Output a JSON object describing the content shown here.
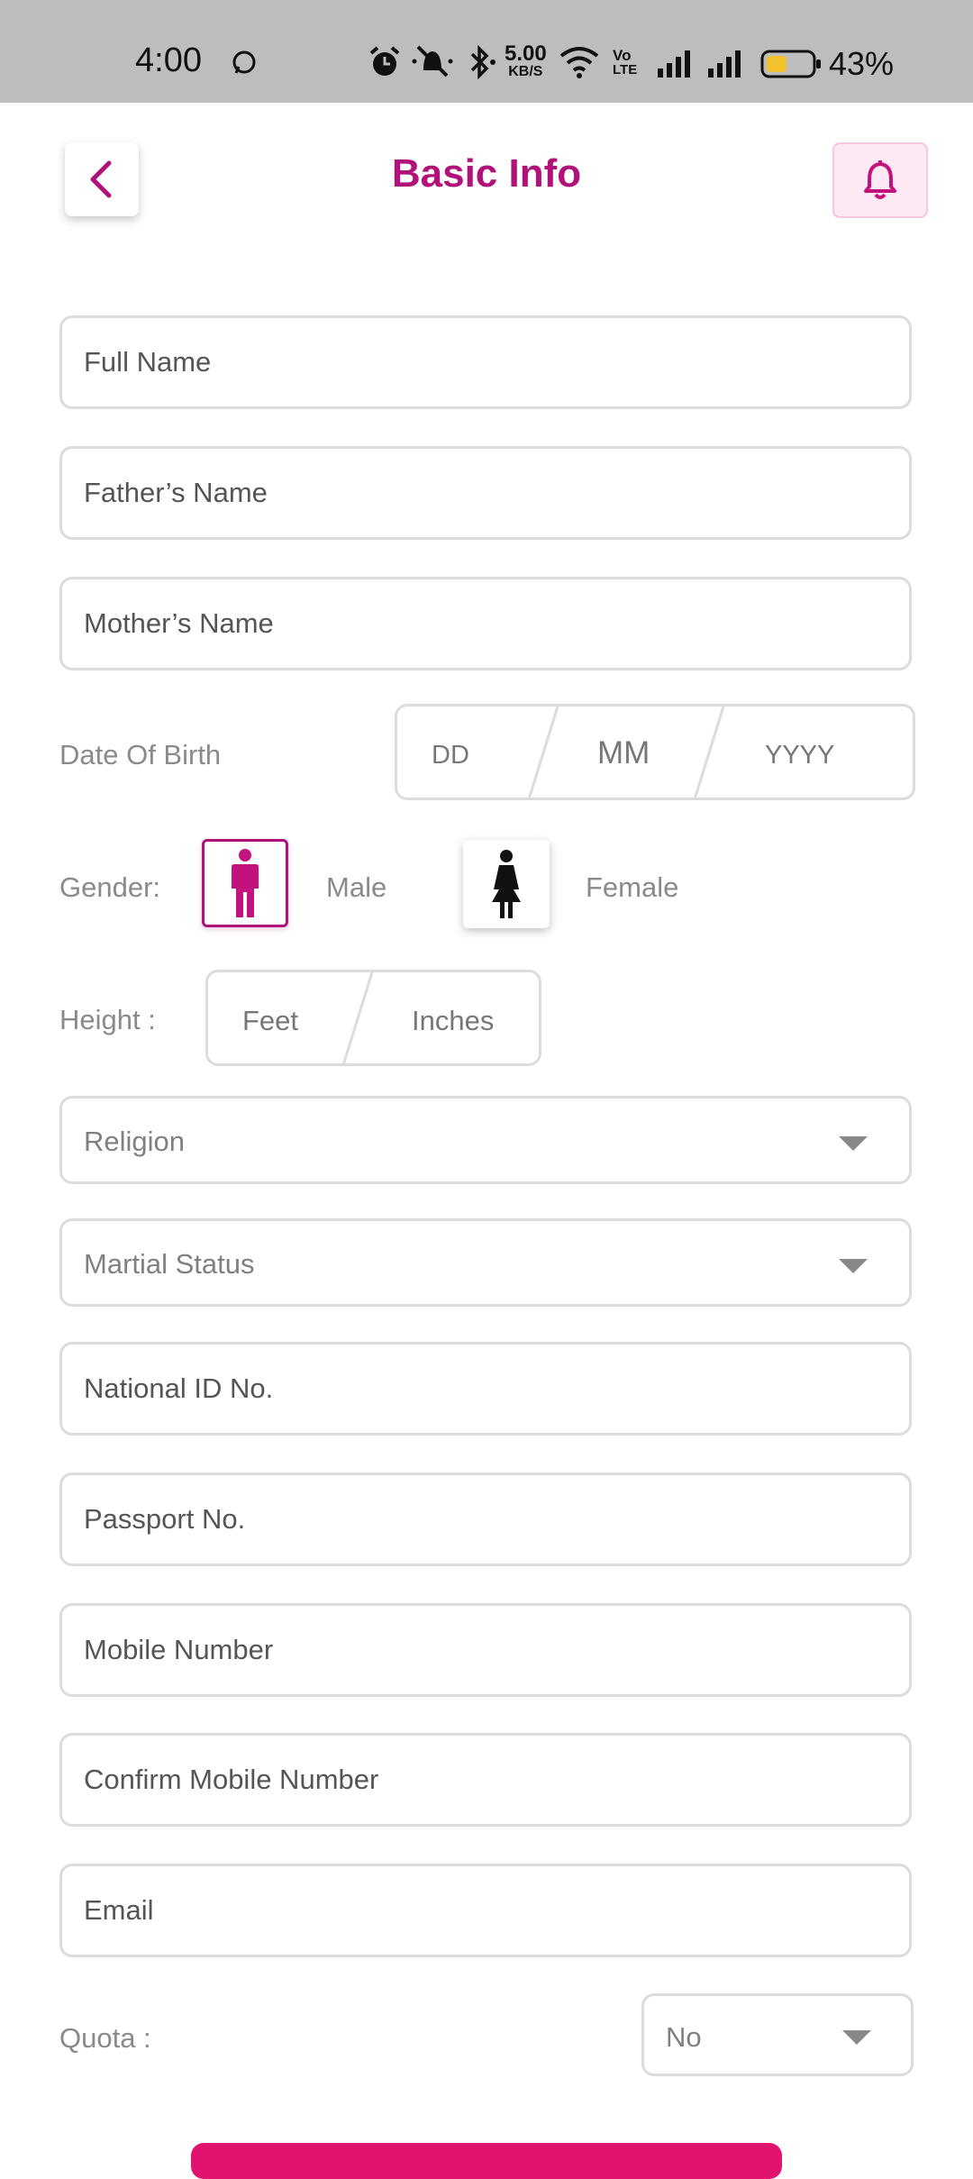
{
  "status_bar": {
    "time": "4:00",
    "network_speed_value": "5.00",
    "network_speed_unit": "KB/S",
    "volte_top": "Vo",
    "volte_bottom": "LTE",
    "battery_percent": "43%",
    "battery_level": 0.43,
    "icons": [
      "whatsapp-icon",
      "alarm-icon",
      "mute-icon",
      "bluetooth-icon",
      "wifi-icon",
      "signal-icon",
      "signal-icon",
      "battery-icon"
    ]
  },
  "header": {
    "title": "Basic Info",
    "back_icon": "chevron-left-icon",
    "notification_icon": "bell-icon"
  },
  "colors": {
    "accent": "#b0127a",
    "submit": "#e0146f",
    "border": "#dcdcdc"
  },
  "form": {
    "full_name": {
      "placeholder": "Full Name",
      "value": ""
    },
    "father_name": {
      "placeholder": "Father’s Name",
      "value": ""
    },
    "mother_name": {
      "placeholder": "Mother’s Name",
      "value": ""
    },
    "dob": {
      "label": "Date Of Birth",
      "day": "DD",
      "month": "MM",
      "year": "YYYY"
    },
    "gender": {
      "label": "Gender:",
      "male": "Male",
      "female": "Female",
      "selected": "Male"
    },
    "height": {
      "label": "Height :",
      "feet": "Feet",
      "inches": "Inches"
    },
    "religion": {
      "label": "Religion"
    },
    "marital_status": {
      "label": "Martial Status"
    },
    "national_id": {
      "placeholder": "National ID No.",
      "value": ""
    },
    "passport": {
      "placeholder": "Passport No.",
      "value": ""
    },
    "mobile": {
      "placeholder": "Mobile Number",
      "value": ""
    },
    "confirm_mobile": {
      "placeholder": "Confirm Mobile Number",
      "value": ""
    },
    "email": {
      "placeholder": "Email",
      "value": ""
    },
    "quota": {
      "label": "Quota :",
      "selected": "No"
    }
  }
}
